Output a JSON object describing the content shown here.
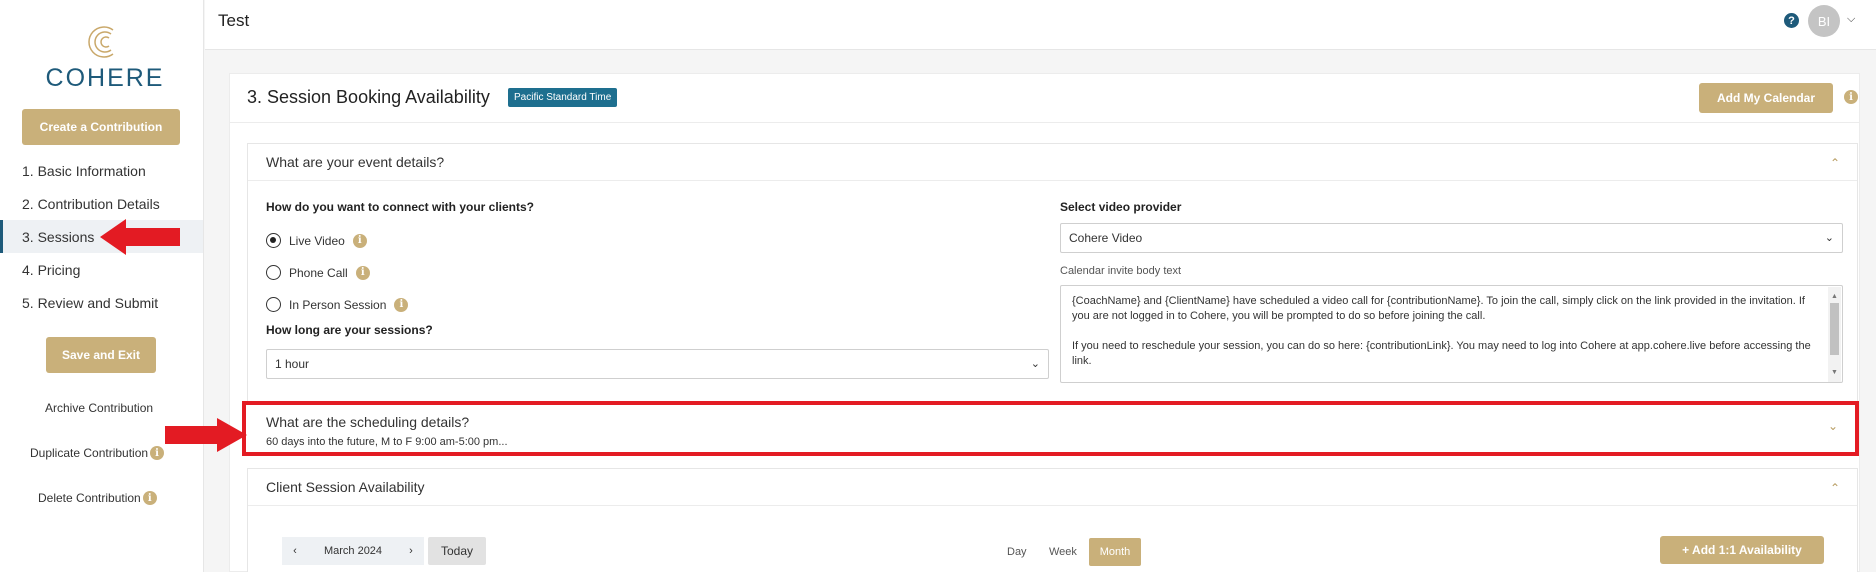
{
  "brand": {
    "name": "COHERE"
  },
  "sidebar": {
    "create_label": "Create a Contribution",
    "steps": [
      {
        "label": "1. Basic Information"
      },
      {
        "label": "2. Contribution Details"
      },
      {
        "label": "3. Sessions"
      },
      {
        "label": "4. Pricing"
      },
      {
        "label": "5. Review and Submit"
      }
    ],
    "save_exit_label": "Save and Exit",
    "archive_label": "Archive Contribution",
    "duplicate_label": "Duplicate Contribution",
    "delete_label": "Delete Contribution"
  },
  "header": {
    "title": "Test",
    "help_glyph": "?",
    "avatar_initials": "BI"
  },
  "main": {
    "title": "3. Session Booking Availability",
    "timezone_badge": "Pacific Standard Time",
    "add_calendar_label": "Add My Calendar",
    "event_panel": {
      "title": "What are your event details?",
      "connect_question": "How do you want to connect with your clients?",
      "options": [
        {
          "label": "Live Video",
          "checked": true
        },
        {
          "label": "Phone Call",
          "checked": false
        },
        {
          "label": "In Person Session",
          "checked": false
        }
      ],
      "length_question": "How long are your sessions?",
      "length_value": "1 hour",
      "video_provider_label": "Select video provider",
      "video_provider_value": "Cohere Video",
      "invite_label": "Calendar invite body text",
      "invite_para1": "{CoachName} and {ClientName} have scheduled a video call for {contributionName}. To join the call, simply click on the link provided in the invitation. If you are not logged in to Cohere, you will be prompted to do so before joining the call.",
      "invite_para2": "If you need to reschedule your session, you can do so here: {contributionLink}. You may need to log into Cohere at app.cohere.live before accessing the link."
    },
    "scheduling_panel": {
      "title": "What are the scheduling details?",
      "summary": "60 days into the future, M to F 9:00 am-5:00 pm..."
    },
    "availability_panel": {
      "title": "Client Session Availability",
      "month_label": "March 2024",
      "today_label": "Today",
      "views": [
        "Day",
        "Week",
        "Month"
      ],
      "add_availability_label": "+ Add 1:1 Availability"
    }
  },
  "colors": {
    "brand_blue": "#1e5a7a",
    "gold": "#c9b07a",
    "highlight_red": "#e31b23"
  }
}
